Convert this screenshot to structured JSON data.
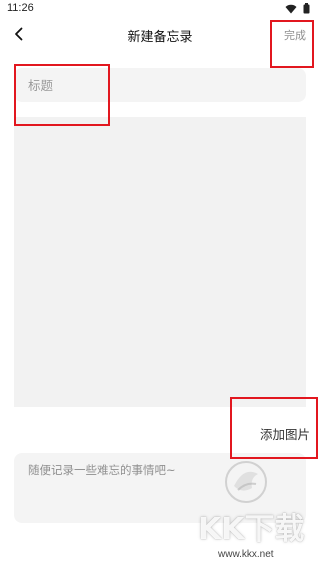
{
  "status_bar": {
    "time": "11:26",
    "icons": [
      "wifi-icon",
      "battery-icon"
    ]
  },
  "nav": {
    "back_icon": "chevron-left-icon",
    "title": "新建备忘录",
    "done_label": "完成"
  },
  "title_input": {
    "placeholder": "标题",
    "value": ""
  },
  "image_area": {
    "add_image_label": "添加图片"
  },
  "note_input": {
    "placeholder": "随便记录一些难忘的事情吧~",
    "value": ""
  },
  "watermark": {
    "text": "KK下载",
    "url": "www.kkx.net"
  },
  "colors": {
    "highlight": "#e2171f",
    "field_background": "#f4f4f4",
    "image_area_background": "#f2f2f2",
    "muted_text": "#8f8f8f"
  }
}
